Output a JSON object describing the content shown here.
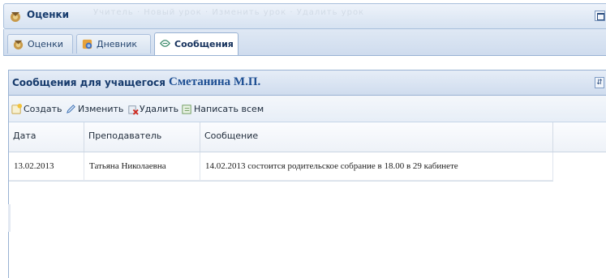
{
  "window": {
    "title": "Оценки",
    "ghost_menu": "Учитель · Новый урок · Изменить урок · Удалить урок",
    "icon": "grades-icon"
  },
  "tabs": [
    {
      "label": "Оценки",
      "icon": "grades-icon",
      "active": false
    },
    {
      "label": "Дневник",
      "icon": "diary-icon",
      "active": false
    },
    {
      "label": "Сообщения",
      "icon": "messages-icon",
      "active": true
    }
  ],
  "panel": {
    "title": "Сообщения для учащегося",
    "student": "Сметанина М.П."
  },
  "toolbar": {
    "create_label": "Создать",
    "edit_label": "Изменить",
    "delete_label": "Удалить",
    "write_all_label": "Написать всем"
  },
  "grid": {
    "columns": [
      "Дата",
      "Преподаватель",
      "Сообщение"
    ],
    "rows": [
      {
        "date": "13.02.2013",
        "teacher": "Татьяна Николаевна",
        "message": "14.02.2013 состоится родительское собрание в 18.00 в 29 кабинете"
      }
    ]
  },
  "colors": {
    "header_blue": "#15396b",
    "student_blue": "#1e4f93",
    "border": "#99b2d3"
  }
}
